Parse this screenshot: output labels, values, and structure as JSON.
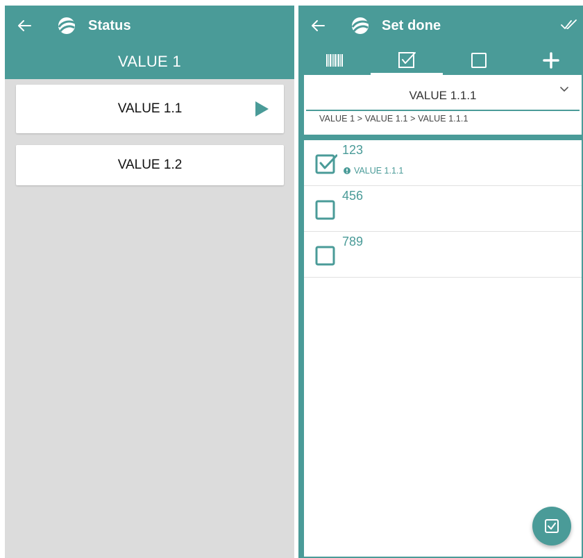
{
  "left": {
    "title": "Status",
    "subtitle": "VALUE 1",
    "items": [
      {
        "label": "VALUE 1.1"
      },
      {
        "label": "VALUE 1.2"
      }
    ]
  },
  "right": {
    "title": "Set done",
    "dropdown": {
      "value": "VALUE 1.1.1",
      "breadcrumb": "VALUE 1 > VALUE 1.1 > VALUE 1.1.1"
    },
    "items": [
      {
        "name": "123",
        "checked": true,
        "note": "VALUE 1.1.1"
      },
      {
        "name": "456",
        "checked": false
      },
      {
        "name": "789",
        "checked": false
      }
    ]
  },
  "colors": {
    "accent": "#4a9b98",
    "panel_bg": "#dcdcdc",
    "white": "#ffffff"
  },
  "icons": [
    "back-arrow-icon",
    "app-logo-icon",
    "play-icon",
    "done-all-icon",
    "barcode-icon",
    "checkbox-checked-icon",
    "checkbox-empty-icon",
    "plus-icon",
    "chevron-down-icon",
    "info-icon"
  ]
}
